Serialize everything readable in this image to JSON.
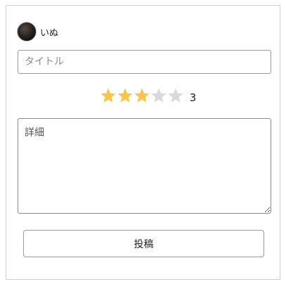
{
  "user": {
    "name": "いぬ",
    "avatar": "avatar-photo"
  },
  "form": {
    "title_placeholder": "タイトル",
    "title_value": "",
    "detail_placeholder": "詳細",
    "detail_value": "",
    "submit_label": "投稿"
  },
  "rating": {
    "value": 3,
    "max": 5,
    "display": "3",
    "icon": "star-icon"
  },
  "colors": {
    "star_filled": "#f9c54b",
    "star_empty": "#d9d9d9",
    "border": "#9a9a9a"
  }
}
